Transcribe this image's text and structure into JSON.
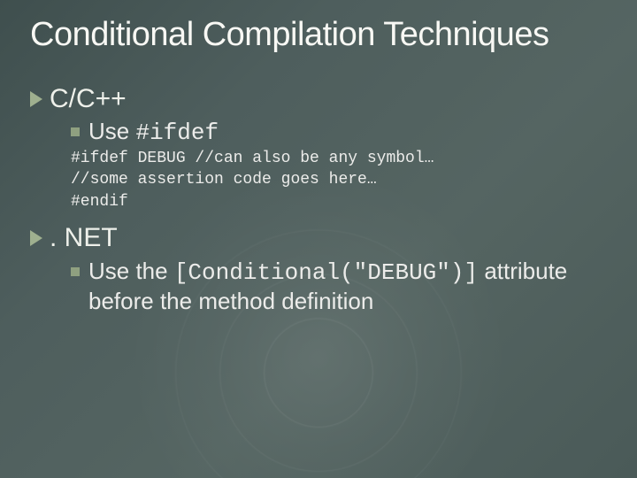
{
  "title": "Conditional Compilation Techniques",
  "sections": [
    {
      "heading": "C/C++",
      "sub": {
        "prefix": "Use ",
        "code": "#ifdef"
      },
      "code_lines": [
        "#ifdef DEBUG //can also be any symbol…",
        "//some assertion code goes here…",
        "#endif"
      ]
    },
    {
      "heading": ". NET",
      "sub": {
        "prefix": "Use the ",
        "code": "[Conditional(\"DEBUG\")]",
        "suffix_line1": " attribute",
        "suffix_line2": "before the method definition"
      }
    }
  ]
}
